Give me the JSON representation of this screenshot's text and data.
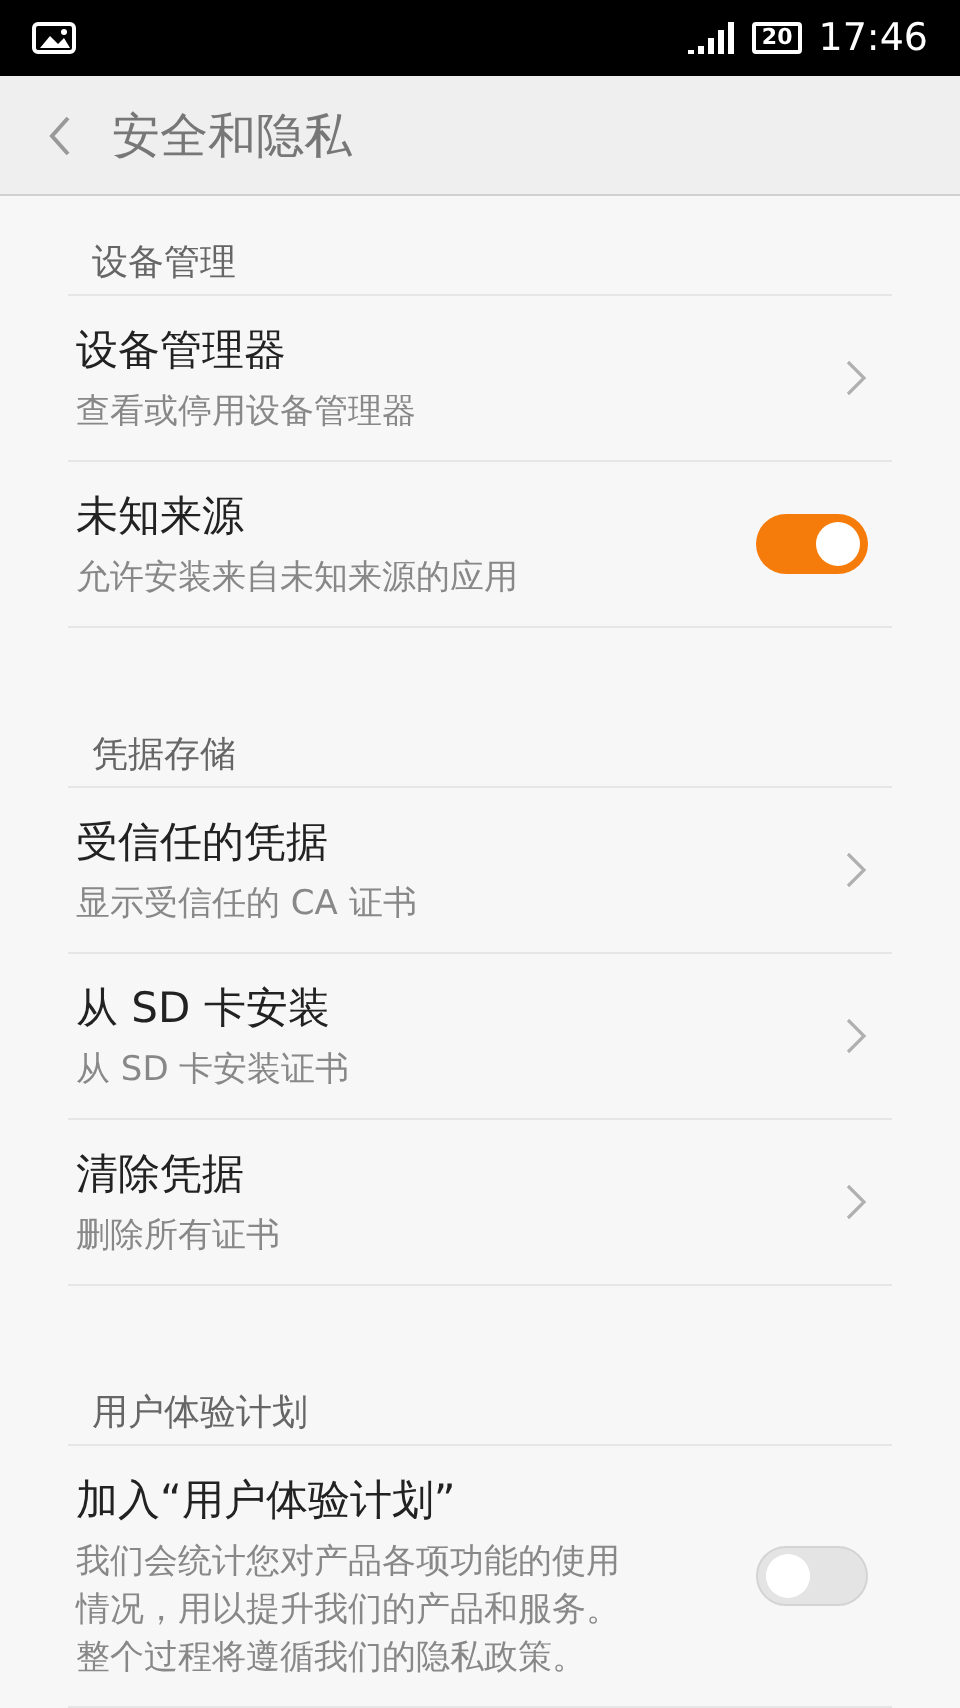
{
  "status_bar": {
    "time": "17:46",
    "battery": "20"
  },
  "header": {
    "title": "安全和隐私"
  },
  "sections": [
    {
      "title": "设备管理",
      "items": [
        {
          "kind": "link",
          "title": "设备管理器",
          "subtitle": "查看或停用设备管理器"
        },
        {
          "kind": "switch",
          "title": "未知来源",
          "subtitle": "允许安装来自未知来源的应用",
          "on": true
        }
      ]
    },
    {
      "title": "凭据存储",
      "items": [
        {
          "kind": "link",
          "title": "受信任的凭据",
          "subtitle": "显示受信任的 CA 证书"
        },
        {
          "kind": "link",
          "title": "从 SD 卡安装",
          "subtitle": "从 SD 卡安装证书"
        },
        {
          "kind": "link",
          "title": "清除凭据",
          "subtitle": "删除所有证书"
        }
      ]
    },
    {
      "title": "用户体验计划",
      "items": [
        {
          "kind": "switch",
          "title": "加入“用户体验计划”",
          "subtitle": "我们会统计您对产品各项功能的使用情况，用以提升我们的产品和服务。整个过程将遵循我们的隐私政策。",
          "on": false
        }
      ]
    }
  ]
}
